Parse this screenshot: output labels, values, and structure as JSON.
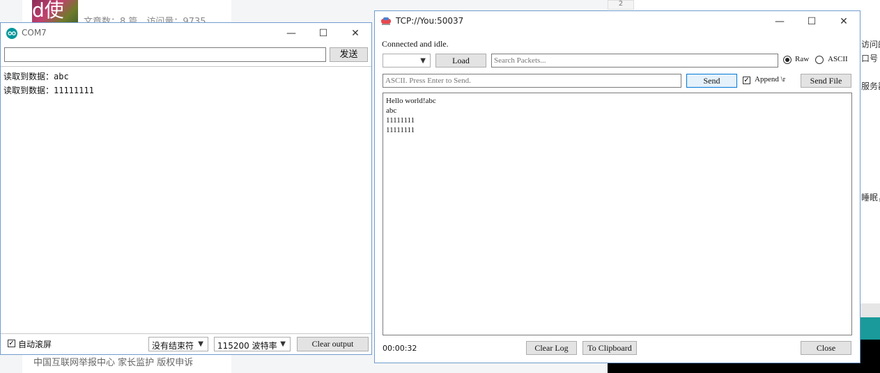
{
  "background": {
    "thumb_text": "d使用",
    "stats": "文章数：8 篇　访问量：9735",
    "footer": "中国互联网举报中心 家长监护 版权申诉",
    "page_number": "2",
    "side_texts": [
      "访问的",
      "口号",
      "服务器",
      "睡眠，"
    ]
  },
  "com7": {
    "title": "COM7",
    "send_label": "发送",
    "input_value": "",
    "lines": [
      "读取到数据：abc",
      "读取到数据：11111111"
    ],
    "autoscroll_label": "自动滚屏",
    "autoscroll_checked": true,
    "line_ending": "没有结束符",
    "baud": "115200 波特率",
    "clear_label": "Clear output"
  },
  "tcp": {
    "title": "TCP://You:50037",
    "status": "Connected and idle.",
    "load_label": "Load",
    "search_placeholder": "Search Packets...",
    "raw_label": "Raw",
    "ascii_label": "ASCII",
    "send_placeholder": "ASCII. Press Enter to Send.",
    "send_label": "Send",
    "append_label": "Append \\r",
    "send_file_label": "Send File",
    "log_lines": [
      "Hello world!abc",
      "abc",
      "11111111",
      "11111111"
    ],
    "timer": "00:00:32",
    "clear_log_label": "Clear Log",
    "clipboard_label": "To Clipboard",
    "close_label": "Close"
  },
  "window_controls": {
    "minimize": "—",
    "maximize": "☐",
    "close": "✕"
  }
}
